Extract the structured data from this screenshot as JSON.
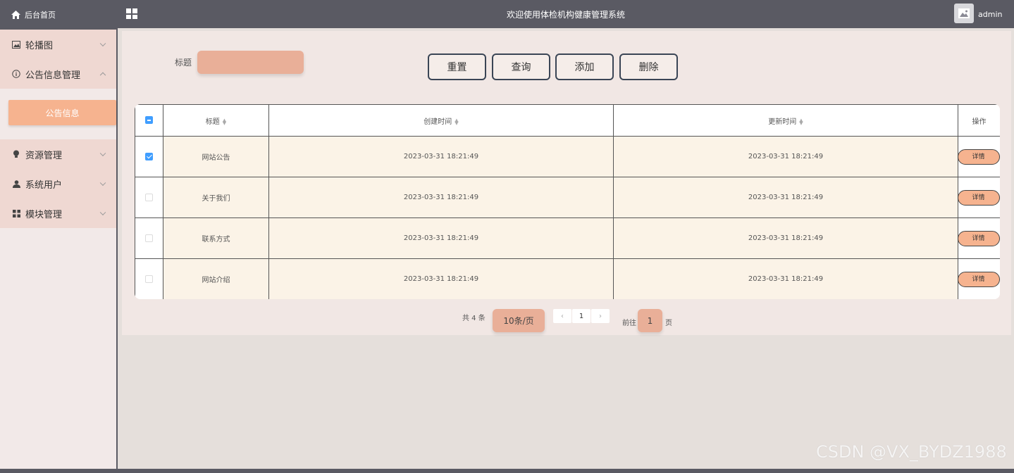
{
  "header": {
    "title": "欢迎使用体检机构健康管理系统",
    "username": "admin",
    "menu_icon": "grid-icon",
    "avatar_icon": "image-icon"
  },
  "sidebar": {
    "home_label": "后台首页",
    "items": [
      {
        "label": "轮播图",
        "icon": "image-icon",
        "expanded": false
      },
      {
        "label": "公告信息管理",
        "icon": "info-icon",
        "expanded": true,
        "children": [
          {
            "label": "公告信息",
            "active": true
          }
        ]
      },
      {
        "label": "资源管理",
        "icon": "bulb-icon",
        "expanded": false
      },
      {
        "label": "系统用户",
        "icon": "user-icon",
        "expanded": false
      },
      {
        "label": "模块管理",
        "icon": "module-icon",
        "expanded": false
      }
    ]
  },
  "search": {
    "label": "标题",
    "value": ""
  },
  "toolbar": {
    "reset": "重置",
    "query": "查询",
    "add": "添加",
    "delete": "删除"
  },
  "table": {
    "columns": [
      "标题",
      "创建时间",
      "更新时间",
      "操作"
    ],
    "detail_label": "详情",
    "rows": [
      {
        "checked": true,
        "title": "网站公告",
        "created": "2023-03-31 18:21:49",
        "updated": "2023-03-31 18:21:49"
      },
      {
        "checked": false,
        "title": "关于我们",
        "created": "2023-03-31 18:21:49",
        "updated": "2023-03-31 18:21:49"
      },
      {
        "checked": false,
        "title": "联系方式",
        "created": "2023-03-31 18:21:49",
        "updated": "2023-03-31 18:21:49"
      },
      {
        "checked": false,
        "title": "网站介绍",
        "created": "2023-03-31 18:21:49",
        "updated": "2023-03-31 18:21:49"
      }
    ]
  },
  "pagination": {
    "total": "共 4 条",
    "page_size": "10条/页",
    "prev": "‹",
    "current_page": "1",
    "next": "›",
    "goto_label": "前往",
    "goto_value": "1",
    "page_suffix": "页"
  },
  "watermark": "CSDN @VX_BYDZ1988",
  "colors": {
    "header_bg": "#5a5a63",
    "accent": "#f6b38f",
    "input_bg": "#e9af98",
    "checkbox": "#409eff"
  }
}
